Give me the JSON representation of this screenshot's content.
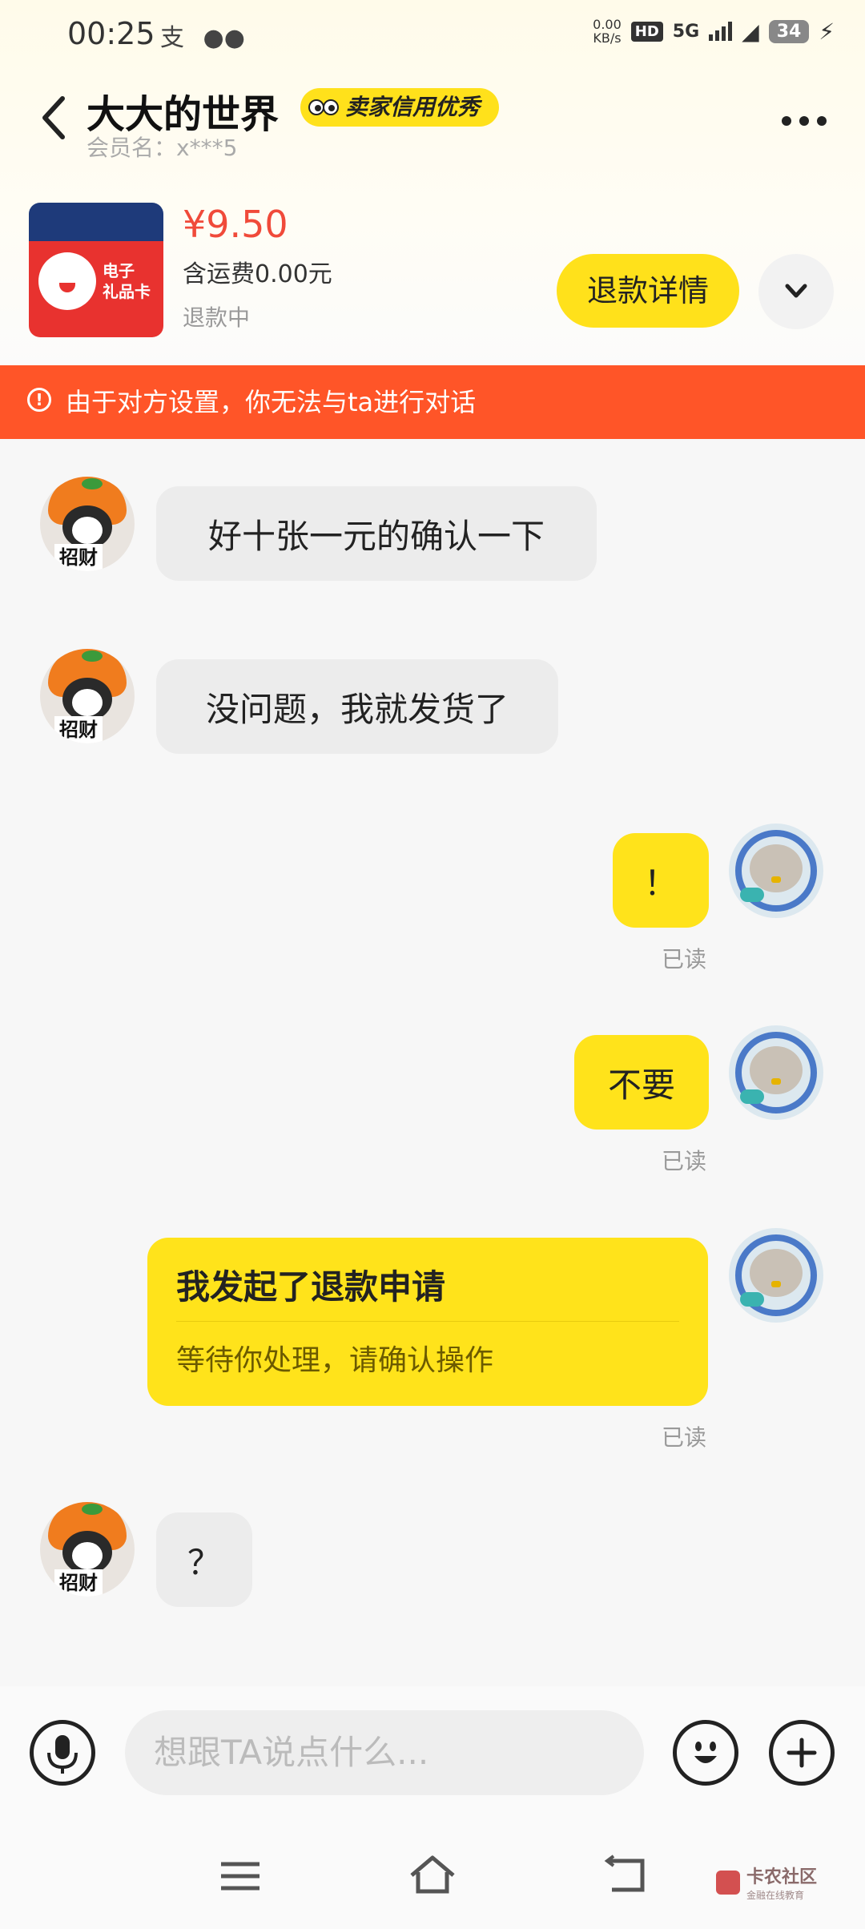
{
  "status_bar": {
    "time": "00:25",
    "net_speed_value": "0.00",
    "net_speed_unit": "KB/s",
    "hd": "HD",
    "network": "5G",
    "battery": "34"
  },
  "header": {
    "title": "大大的世界",
    "badge": "卖家信用优秀",
    "member": "会员名：x***5"
  },
  "product": {
    "price": "¥9.50",
    "freight": "含运费0.00元",
    "status": "退款中",
    "thumb_text": "电子\n礼品卡",
    "refund_button": "退款详情"
  },
  "warning": {
    "text": "由于对方设置，你无法与ta进行对话"
  },
  "messages": [
    {
      "side": "in",
      "text": "好十张一元的确认一下"
    },
    {
      "side": "in",
      "text": "没问题，我就发货了"
    },
    {
      "side": "out",
      "text": "！",
      "status": "已读"
    },
    {
      "side": "out",
      "text": "不要",
      "status": "已读"
    },
    {
      "side": "out",
      "title": "我发起了退款申请",
      "subtitle": "等待你处理，请确认操作",
      "status": "已读"
    },
    {
      "side": "in",
      "text": "？"
    }
  ],
  "input": {
    "placeholder": "想跟TA说点什么..."
  },
  "watermark": {
    "name": "卡农社区",
    "tagline": "金融在线教育"
  },
  "avatars": {
    "peer_sign": "招财"
  },
  "colors": {
    "accent_yellow": "#ffe11b",
    "warning_orange": "#ff5528",
    "price_red": "#f04a3a"
  }
}
